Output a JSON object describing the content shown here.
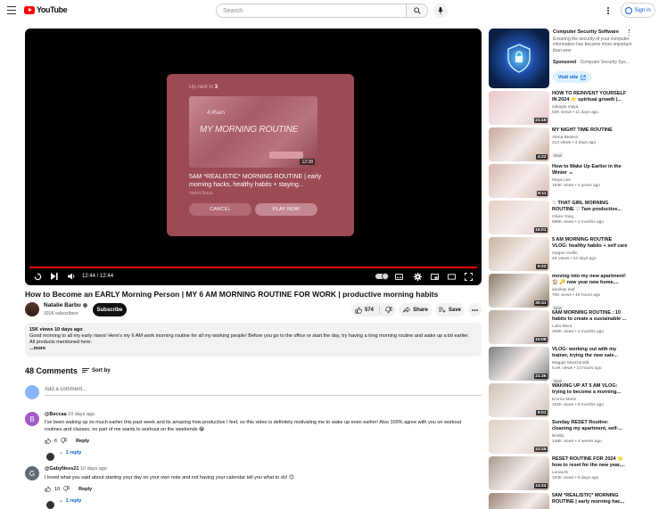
{
  "header": {
    "logo_text": "YouTube",
    "search_placeholder": "Search",
    "signin_label": "Sign in"
  },
  "player": {
    "up_next_prefix": "Up next in",
    "up_next_seconds": "3",
    "next_thumb_time": "4:45am",
    "next_thumb_text": "MY MORNING ROUTINE",
    "next_duration": "12:38",
    "next_title": "5AM *REALISTIC* MORNING ROUTINE | early morning hacks, healthy habits + staying...",
    "next_channel": "naomi lkasa",
    "cancel_label": "CANCEL",
    "play_now_label": "PLAY NOW",
    "time_display": "12:44 / 12:44",
    "progress_fraction": 1.0
  },
  "video": {
    "title": "How to Become an EARLY Morning Person | MY 6 AM MORNING ROUTINE FOR WORK | productive morning habits",
    "channel": "Natalie Barbu",
    "subscribers": "301K subscribers",
    "subscribe_label": "Subscribe",
    "likes": "574",
    "share_label": "Share",
    "save_label": "Save"
  },
  "description": {
    "meta": "15K views  10 days ago",
    "text": "Good morning to all my early risers! Here's my 6 AM work morning routine for all my working people! Before you go to the office or start the day, try having a long morning routine and wake up a bit earlier.",
    "line2": "All products mentioned here:",
    "more_label": "...more"
  },
  "comments": {
    "count_label": "48 Comments",
    "sort_label": "Sort by",
    "add_placeholder": "Add a comment...",
    "items": [
      {
        "avatar_letter": "B",
        "avatar_color": "#a35cc9",
        "author": "@Beccaa",
        "time": "10 days ago",
        "text_1": "I've been waking up so much earlier this past week and its amazing how productive I feel, so this video is definitely motivating me to wake up even earlier! Also 100% agree with you on workout",
        "text_2": "routines and classes, no part of me wants to workout on the weekends 😂",
        "likes": "6",
        "reply_label": "Reply",
        "replies_label": "1 reply"
      },
      {
        "avatar_letter": "G",
        "avatar_color": "#5f6b74",
        "author": "@GabyNess21",
        "time": "10 days ago",
        "text_1": "I loved what you said about starting your day on your own note and not having your calendar tell you what to do! 😊",
        "text_2": "",
        "likes": "10",
        "reply_label": "Reply",
        "replies_label": "1 reply"
      }
    ]
  },
  "ad": {
    "title": "Computer Security Software",
    "description": "Ensuring the security of your computer information has become more important than ever",
    "sponsored": "Sponsored",
    "advertiser": "· Computer Security Sys...",
    "visit_label": "Visit site"
  },
  "related": [
    {
      "title": "HOW TO REINVENT YOURSELF IN 2024 ⭐ spiritual growth |...",
      "channel": "mikayla maya",
      "stats": "53K views • 11 days ago",
      "duration": "21:15",
      "is_new": false,
      "thumb_color": "#e9c6c9"
    },
    {
      "title": "MY NIGHT TIME ROUTINE",
      "channel": "Alena Besera",
      "stats": "213 views • 3 days ago",
      "duration": "4:22",
      "is_new": true,
      "new_label": "New",
      "thumb_color": "#c7a99a"
    },
    {
      "title": "How to Wake Up Earlier in the Winter ☕",
      "channel": "Maya Lee",
      "stats": "193K views • 2 years ago",
      "duration": "8:11",
      "is_new": false,
      "thumb_color": "#d8b8b0"
    },
    {
      "title": "♡ THAT GIRL MORNING ROUTINE ♡ 7am productive...",
      "channel": "Olivia Yang",
      "stats": "595K views • 2 months ago",
      "duration": "16:01",
      "is_new": false,
      "thumb_color": "#e3cfc4"
    },
    {
      "title": "5 AM MORNING ROUTINE VLOG: healthy habits + self care",
      "channel": "megan mullin",
      "stats": "4K views • 12 days ago",
      "duration": "5:22",
      "is_new": false,
      "thumb_color": "#c9b49f"
    },
    {
      "title": "moving into my new apartment! 🏠 🔑 new year new home,...",
      "channel": "annikas leaf",
      "stats": "70K views • 19 hours ago",
      "duration": "30:41",
      "is_new": true,
      "new_label": "New",
      "thumb_color": "#8a7a66"
    },
    {
      "title": "6AM MORNING ROUTINE : 10 habits to create a sustainable ...",
      "channel": "Lidia Mera",
      "stats": "299K views • 2 months ago",
      "duration": "10:08",
      "is_new": false,
      "thumb_color": "#b9aba0"
    },
    {
      "title": "VLOG: working out with my trainer, trying the new saie...",
      "channel": "Maggie MacDonald",
      "stats": "6.4K views • 14 hours ago",
      "duration": "21:36",
      "is_new": true,
      "new_label": "New",
      "thumb_color": "#7d7f80"
    },
    {
      "title": "WAKING UP AT 5 AM VLOG: trying to become a morning...",
      "channel": "Emma Marie",
      "stats": "102K views • 9 months ago",
      "duration": "9:01",
      "is_new": false,
      "thumb_color": "#cfc2b5"
    },
    {
      "title": "Sunday RESET Routine: cleaning my apartment, self-...",
      "channel": "Briddy",
      "stats": "146K views • 4 weeks ago",
      "duration": "12:25",
      "is_new": false,
      "thumb_color": "#ddd1c4"
    },
    {
      "title": "RESET ROUTINE FOR 2024 🌟 how to reset for the new year,...",
      "channel": "LenaLife",
      "stats": "184K views • 6 days ago",
      "duration": "13:24",
      "is_new": false,
      "thumb_color": "#a99a90"
    },
    {
      "title": "5AM *REALISTIC* MORNING ROUTINE | early morning hac...",
      "channel": "",
      "stats": "",
      "duration": "",
      "is_new": false,
      "thumb_color": "#9d8478"
    }
  ]
}
